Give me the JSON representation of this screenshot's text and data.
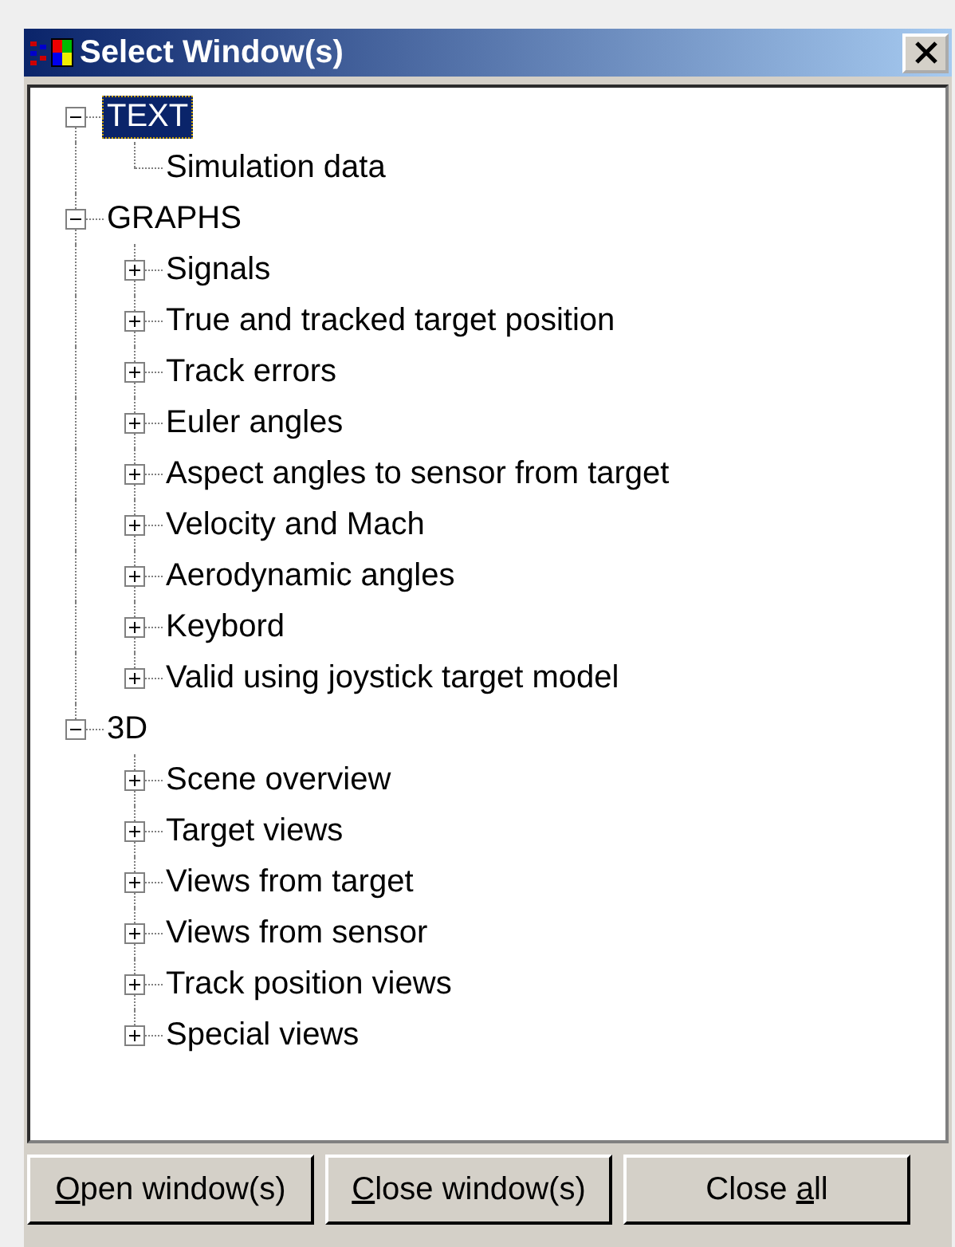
{
  "window": {
    "title": "Select Window(s)"
  },
  "tree": [
    {
      "label": "TEXT",
      "kind": "folder",
      "expanded": true,
      "selected": true,
      "children": [
        {
          "label": "Simulation data",
          "kind": "leaf",
          "selected": false
        }
      ]
    },
    {
      "label": "GRAPHS",
      "kind": "folder",
      "expanded": true,
      "selected": false,
      "children": [
        {
          "label": "Signals",
          "kind": "folder",
          "expanded": false,
          "selected": false
        },
        {
          "label": "True and tracked target position",
          "kind": "folder",
          "expanded": false,
          "selected": false
        },
        {
          "label": "Track errors",
          "kind": "folder",
          "expanded": false,
          "selected": false
        },
        {
          "label": "Euler angles",
          "kind": "folder",
          "expanded": false,
          "selected": false
        },
        {
          "label": "Aspect angles to sensor from target",
          "kind": "folder",
          "expanded": false,
          "selected": false
        },
        {
          "label": "Velocity and Mach",
          "kind": "folder",
          "expanded": false,
          "selected": false
        },
        {
          "label": "Aerodynamic angles",
          "kind": "folder",
          "expanded": false,
          "selected": false
        },
        {
          "label": "Keybord",
          "kind": "folder",
          "expanded": false,
          "selected": false
        },
        {
          "label": "Valid using joystick target model",
          "kind": "folder",
          "expanded": false,
          "selected": false
        }
      ]
    },
    {
      "label": "3D",
      "kind": "folder",
      "expanded": true,
      "selected": false,
      "children": [
        {
          "label": "Scene overview",
          "kind": "folder",
          "expanded": false,
          "selected": false
        },
        {
          "label": "Target views",
          "kind": "folder",
          "expanded": false,
          "selected": false
        },
        {
          "label": "Views from target",
          "kind": "folder",
          "expanded": false,
          "selected": false
        },
        {
          "label": "Views from sensor",
          "kind": "folder",
          "expanded": false,
          "selected": false
        },
        {
          "label": "Track position views",
          "kind": "folder",
          "expanded": false,
          "selected": false
        },
        {
          "label": "Special views",
          "kind": "folder",
          "expanded": false,
          "selected": false
        }
      ]
    }
  ],
  "buttons": [
    {
      "key": "O",
      "after": "pen window(s)"
    },
    {
      "key": "C",
      "after": "lose window(s)"
    },
    {
      "before": "Close ",
      "key": "a",
      "after": "ll"
    }
  ]
}
